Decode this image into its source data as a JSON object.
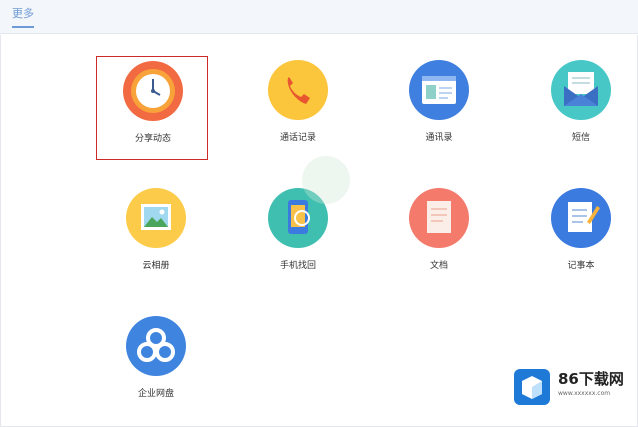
{
  "header": {
    "tab_label": "更多"
  },
  "apps": [
    {
      "label": "分享动态",
      "icon": "clock-icon",
      "color": "#f26a41"
    },
    {
      "label": "通话记录",
      "icon": "phone-icon",
      "color": "#fbc53c"
    },
    {
      "label": "通讯录",
      "icon": "contact-card-icon",
      "color": "#3f7fe0"
    },
    {
      "label": "短信",
      "icon": "envelope-icon",
      "color": "#47c8c6"
    },
    {
      "label": "云相册",
      "icon": "picture-icon",
      "color": "#fbcb49"
    },
    {
      "label": "手机找回",
      "icon": "phone-locate-icon",
      "color": "#3fbfb0"
    },
    {
      "label": "文档",
      "icon": "document-icon",
      "color": "#f47a6c"
    },
    {
      "label": "记事本",
      "icon": "notepad-icon",
      "color": "#3b7be0"
    },
    {
      "label": "企业网盘",
      "icon": "cloud-icon",
      "color": "#3f85e0"
    }
  ],
  "watermark": {
    "title": "86下载网",
    "subtitle": "www.xxxxxx.com"
  }
}
